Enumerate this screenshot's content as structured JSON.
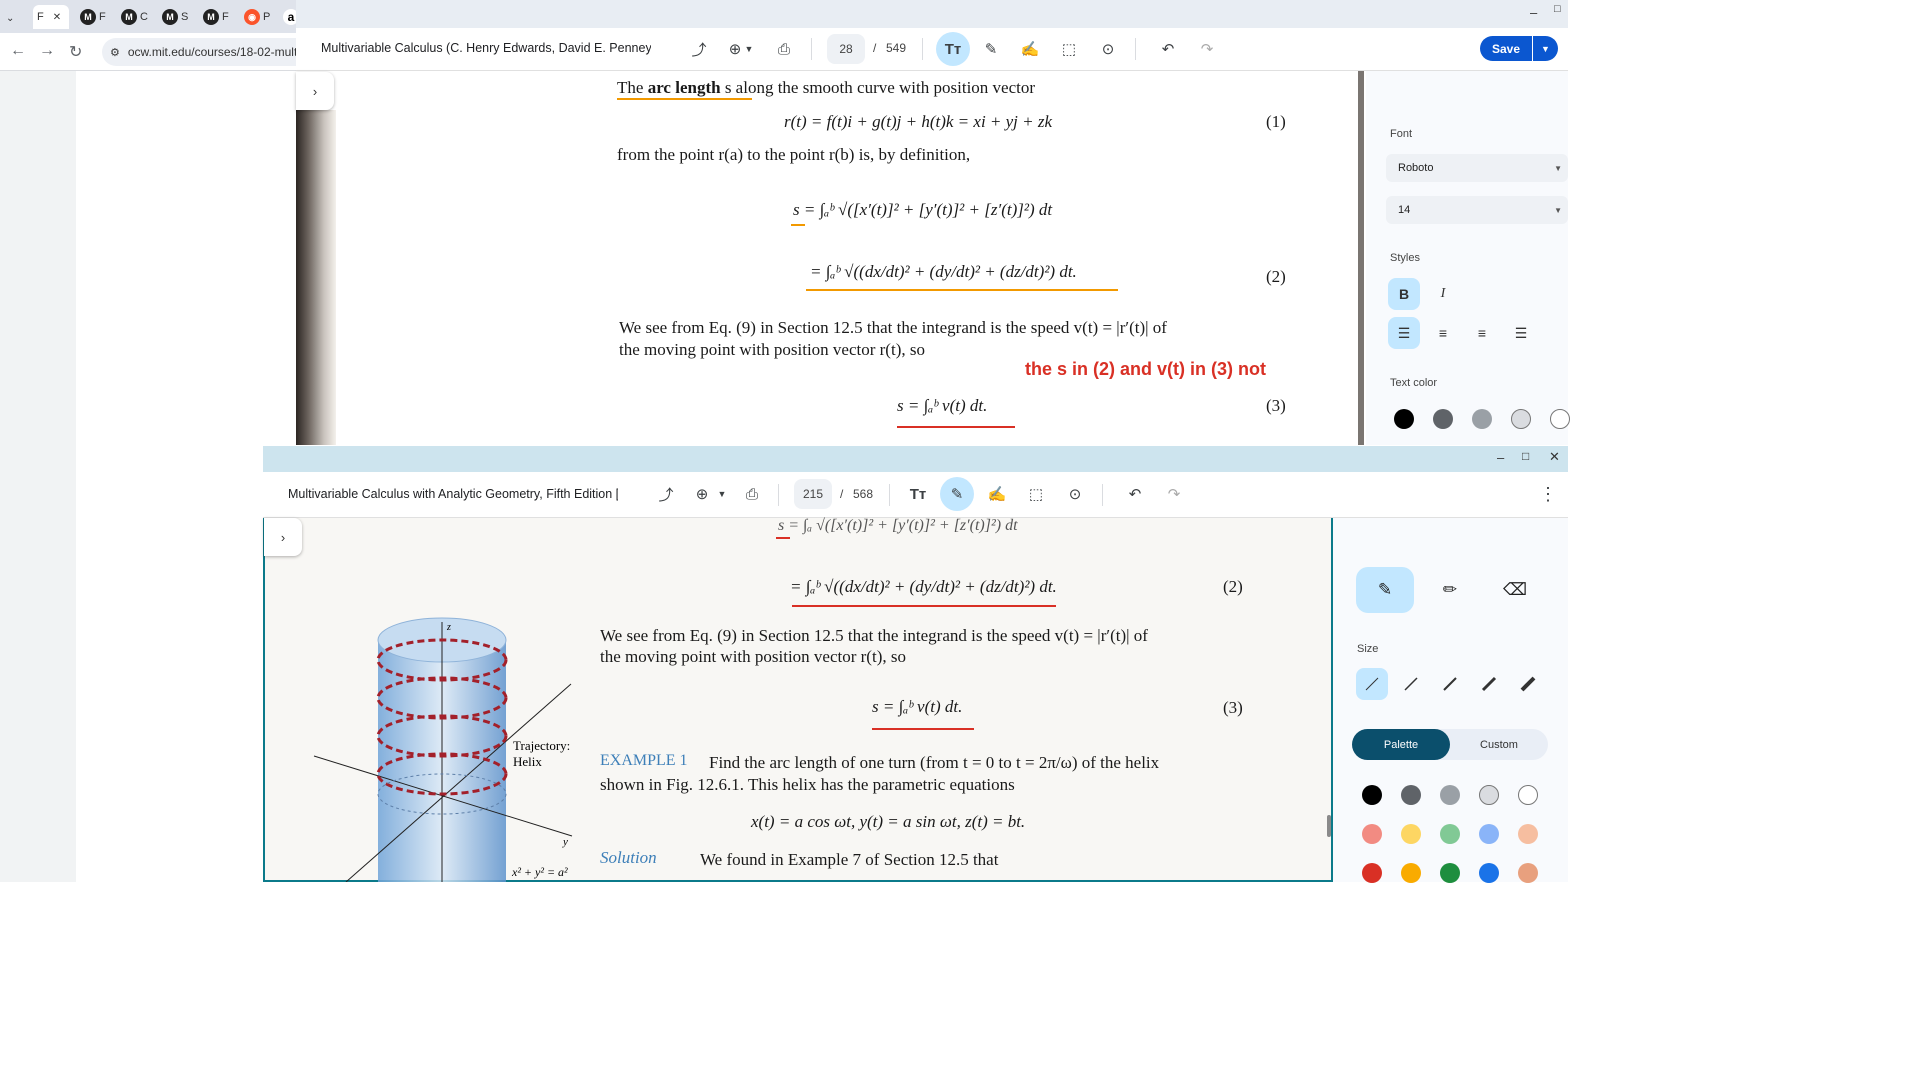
{
  "browser": {
    "tabs": [
      {
        "label": "F",
        "icon": "page-icon"
      },
      {
        "label": "F",
        "icon": "mit-icon"
      },
      {
        "label": "C",
        "icon": "mit-icon"
      },
      {
        "label": "S",
        "icon": "mit-icon"
      },
      {
        "label": "F",
        "icon": "mit-icon"
      },
      {
        "label": "P",
        "icon": "brave-icon"
      },
      {
        "label": "a",
        "icon": "amazon-icon"
      }
    ],
    "close_glyph": "✕",
    "url": "ocw.mit.edu/courses/18-02-mult"
  },
  "window1": {
    "title": "Multivariable Calculus (C. Henry Edwards, David E. Penney) (",
    "page_current": "28",
    "page_total": "549",
    "save_label": "Save",
    "document": {
      "line1_pre": "The ",
      "line1_bold": "arc length",
      "line1_post": " s along the smooth curve with position vector",
      "eq1": "r(t) = f(t)i + g(t)j + h(t)k = xi + yj + zk",
      "eq1_num": "(1)",
      "line2": "from the point r(a) to the point r(b) is, by definition,",
      "eq2a": "s = ∫ₐᵇ √([x′(t)]² + [y′(t)]² + [z′(t)]²) dt",
      "eq2b": "= ∫ₐᵇ √((dx/dt)² + (dy/dt)² + (dz/dt)²) dt.",
      "eq2_num": "(2)",
      "line3": "We see from Eq. (9) in Section 12.5 that the integrand is the speed v(t) = |r′(t)| of",
      "line4": "the moving point with position vector r(t), so",
      "eq3": "s = ∫ₐᵇ v(t) dt.",
      "eq3_num": "(3)"
    },
    "annotation": "the s in (2) and v(t) in (3) not",
    "sidebar": {
      "font_label": "Font",
      "font_value": "Roboto",
      "size_value": "14",
      "styles_label": "Styles",
      "bold": "B",
      "italic": "I",
      "text_color_label": "Text color",
      "colors": [
        "#000000",
        "#5f6368",
        "#9aa0a6",
        "#dadce0",
        "#ffffff"
      ]
    }
  },
  "window2": {
    "title": "Multivariable Calculus with Analytic Geometry, Fifth Edition [",
    "page_current": "215",
    "page_total": "568",
    "document": {
      "eq_top": "s = ∫ₐ √([x′(t)]² + [y′(t)]² + [z′(t)]²) dt",
      "eq2b": "= ∫ₐᵇ √((dx/dt)² + (dy/dt)² + (dz/dt)²) dt.",
      "eq2_num": "(2)",
      "line3": "We see from Eq. (9) in Section 12.5 that the integrand is the speed v(t) = |r′(t)| of",
      "line4": "the moving point with position vector r(t), so",
      "eq3": "s = ∫ₐᵇ v(t) dt.",
      "eq3_num": "(3)",
      "example_label": "EXAMPLE 1",
      "example_text1": "Find the arc length of one turn (from t = 0 to t = 2π/ω) of the helix",
      "example_text2": "shown in Fig. 12.6.1. This helix has the parametric equations",
      "param_eqs": "x(t) = a cos ωt,     y(t) = a sin ωt,     z(t) = bt.",
      "solution_label": "Solution",
      "solution_text": "We found in Example 7 of Section 12.5 that",
      "fig_label1": "Trajectory:",
      "fig_label2": "Helix",
      "fig_z": "z",
      "fig_y": "y",
      "fig_eq": "x² + y² = a²"
    },
    "sidebar": {
      "size_label": "Size",
      "palette_label": "Palette",
      "custom_label": "Custom",
      "colors_row1": [
        "#000000",
        "#5f6368",
        "#9aa0a6",
        "#dadce0",
        "#ffffff"
      ],
      "colors_row2": [
        "#f28b82",
        "#fdd663",
        "#81c995",
        "#8ab4f8",
        "#f6bea0"
      ],
      "colors_row3": [
        "#d93025",
        "#f9ab00",
        "#1e8e3e",
        "#1a73e8",
        "#e8a07e"
      ]
    }
  },
  "theme": {
    "accent": "#0b57d0",
    "active_tool": "#c2e7ff",
    "annotation_red": "#d93025",
    "highlight_orange": "#f29900",
    "example_blue": "#3d7fb8"
  }
}
